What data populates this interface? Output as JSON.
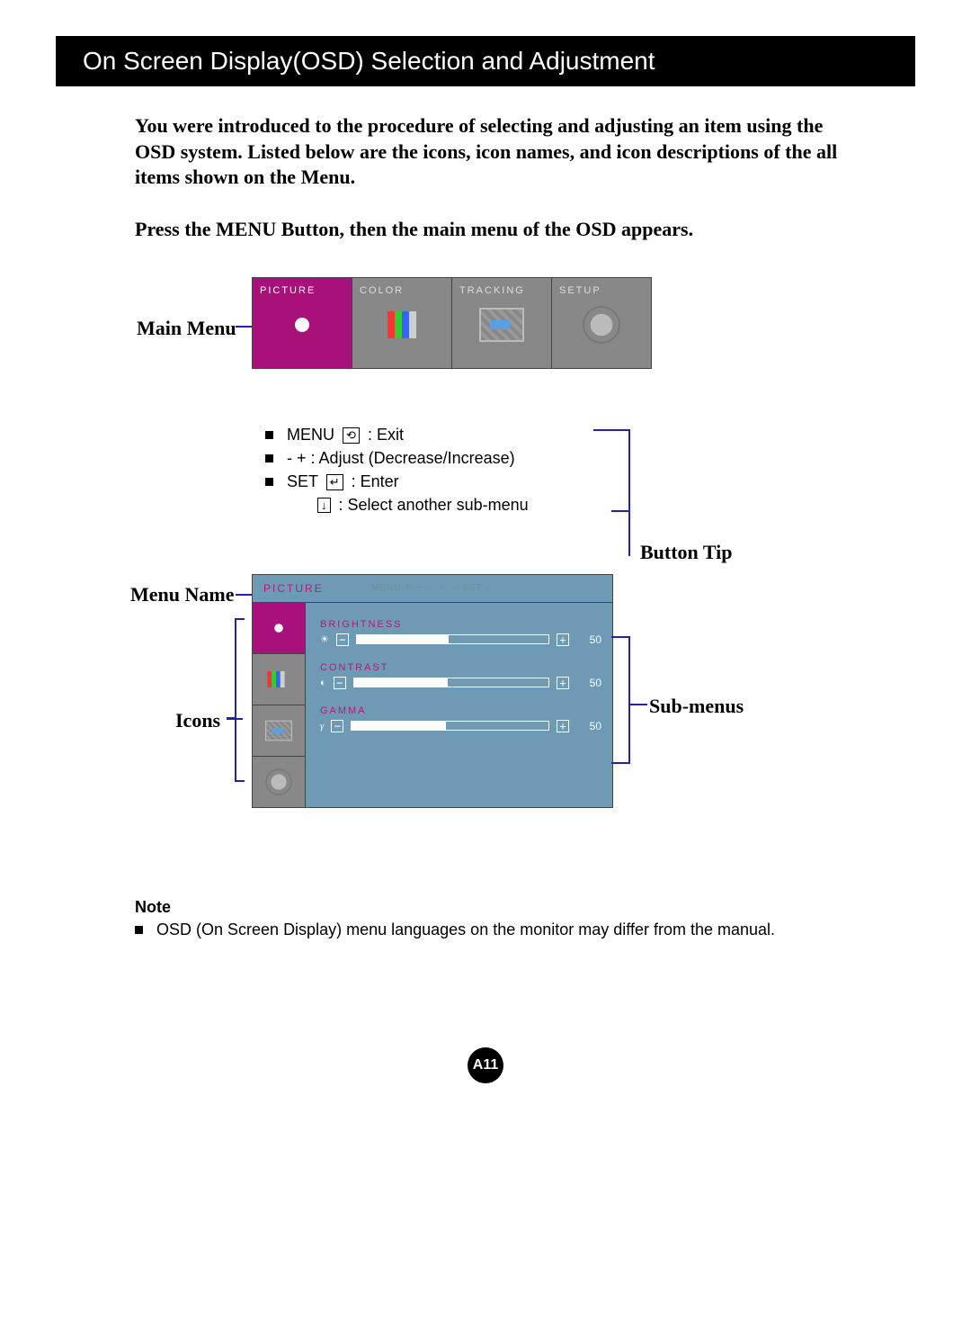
{
  "header": {
    "title": "On Screen Display(OSD) Selection and Adjustment"
  },
  "intro": "You were introduced to the procedure of selecting and adjusting an item using the OSD system.  Listed below are the icons, icon names, and icon descriptions of the all items shown on the Menu.",
  "press": "Press the MENU Button, then the main menu of the OSD appears.",
  "labels": {
    "main_menu": "Main Menu",
    "button_tip": "Button Tip",
    "menu_name": "Menu Name",
    "icons": "Icons",
    "sub_menus": "Sub-menus"
  },
  "tabs": [
    {
      "label": "PICTURE",
      "icon": "brightness-icon",
      "active": true
    },
    {
      "label": "COLOR",
      "icon": "color-bars-icon",
      "active": false
    },
    {
      "label": "TRACKING",
      "icon": "tracking-icon",
      "active": false
    },
    {
      "label": "SETUP",
      "icon": "gear-icon",
      "active": false
    }
  ],
  "controls": [
    {
      "key": "MENU",
      "glyph": "⟲",
      "desc": ": Exit"
    },
    {
      "key": "- +",
      "glyph": "",
      "desc": ": Adjust (Decrease/Increase)"
    },
    {
      "key": "SET",
      "glyph": "↵",
      "desc": ": Enter"
    },
    {
      "key": "",
      "glyph": "↓",
      "desc": ": Select another sub-menu"
    }
  ],
  "submenu": {
    "title": "PICTURE",
    "hints": "MENU ⟲   − ←   + →   SET  ↓",
    "side": [
      {
        "icon": "brightness-icon",
        "active": true
      },
      {
        "icon": "color-bars-icon",
        "active": false
      },
      {
        "icon": "tracking-icon",
        "active": false
      },
      {
        "icon": "gear-icon",
        "active": false
      }
    ],
    "items": [
      {
        "name": "BRIGHTNESS",
        "symbol": "☀",
        "value": "50"
      },
      {
        "name": "CONTRAST",
        "symbol": "◐",
        "value": "50"
      },
      {
        "name": "GAMMA",
        "symbol": "γ",
        "value": "50"
      }
    ]
  },
  "note": {
    "heading": "Note",
    "text": "OSD (On Screen Display) menu languages on the monitor may differ from the manual."
  },
  "page_number": "A11",
  "colors": {
    "magenta": "#a8117a",
    "steel": "#6e9ab6",
    "blue_line": "#2222aa"
  }
}
